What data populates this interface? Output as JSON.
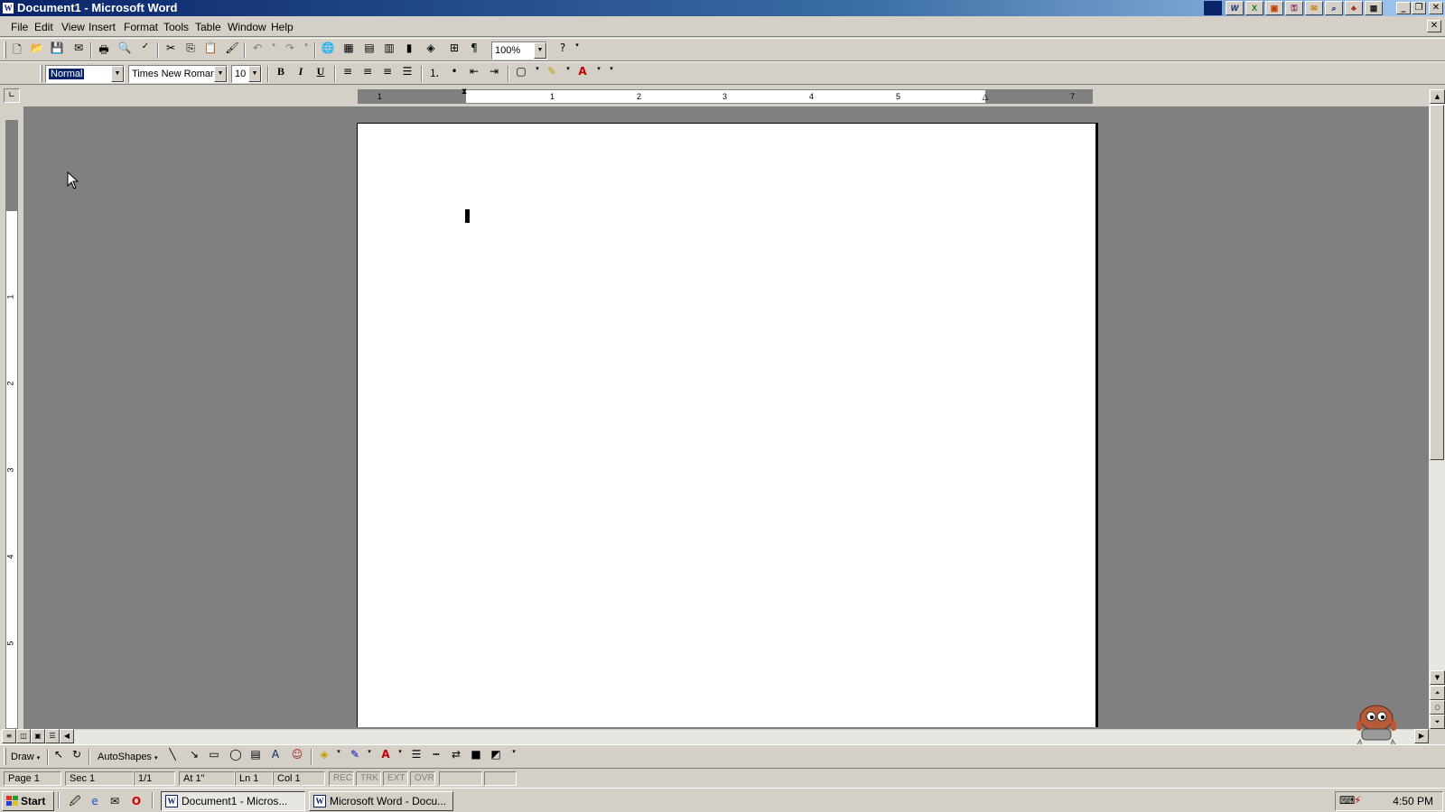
{
  "window": {
    "title": "Document1 - Microsoft Word",
    "app_icon": "W"
  },
  "title_tray_apps": [
    "word-icon",
    "excel-icon",
    "powerpoint-icon",
    "access-icon",
    "outlook-icon",
    "binder-icon",
    "shortcut-icon",
    "office-icon"
  ],
  "caption_buttons": {
    "minimize": "_",
    "restore": "❐",
    "close": "✕"
  },
  "menu": {
    "items": [
      {
        "label": "File",
        "key": "F"
      },
      {
        "label": "Edit",
        "key": "E"
      },
      {
        "label": "View",
        "key": "V"
      },
      {
        "label": "Insert",
        "key": "I"
      },
      {
        "label": "Format",
        "key": "o"
      },
      {
        "label": "Tools",
        "key": "T"
      },
      {
        "label": "Table",
        "key": "a"
      },
      {
        "label": "Window",
        "key": "W"
      },
      {
        "label": "Help",
        "key": "H"
      }
    ],
    "doc_close": "✕"
  },
  "standard_toolbar": {
    "zoom": "100%"
  },
  "formatting_toolbar": {
    "style": "Normal",
    "font": "Times New Roman",
    "size": "10",
    "bold": "B",
    "italic": "I",
    "underline": "U"
  },
  "ruler": {
    "numbers": [
      "1",
      "1",
      "2",
      "3",
      "4",
      "5",
      "7"
    ]
  },
  "vertical_ruler": {
    "numbers": [
      "1",
      "2",
      "3",
      "4",
      "5"
    ]
  },
  "drawing_toolbar": {
    "draw_label": "Draw",
    "autoshapes_label": "AutoShapes"
  },
  "status": {
    "page": "Page 1",
    "sec": "Sec 1",
    "page_of": "1/1",
    "at": "At 1\"",
    "ln": "Ln 1",
    "col": "Col 1",
    "rec": "REC",
    "trk": "TRK",
    "ext": "EXT",
    "ovr": "OVR"
  },
  "taskbar": {
    "start_label": "Start",
    "tasks": [
      {
        "label": "Document1 - Micros...",
        "active": true
      },
      {
        "label": "Microsoft Word - Docu...",
        "active": false
      }
    ],
    "clock": "4:50 PM"
  },
  "colors": {
    "title_gradient_start": "#0a246a",
    "title_gradient_end": "#a6caf0",
    "workspace": "#808080",
    "chrome": "#d4d0c8"
  }
}
